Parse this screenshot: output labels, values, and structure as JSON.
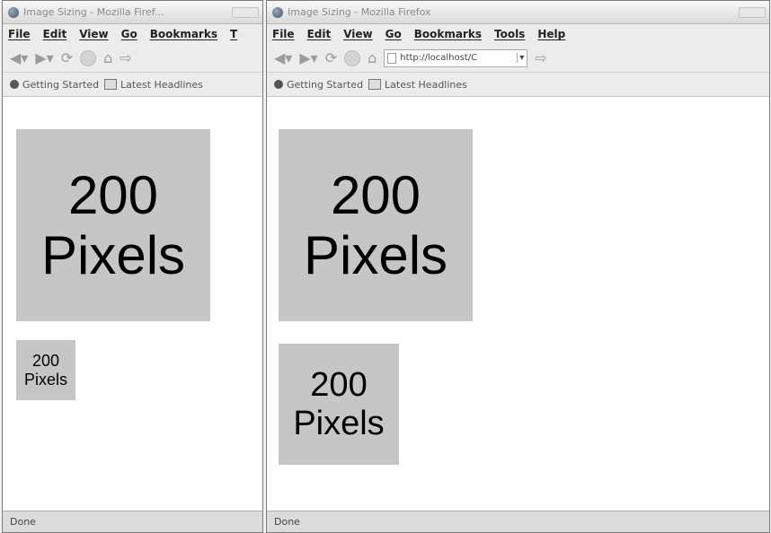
{
  "windows": {
    "left": {
      "title": "Image Sizing - Mozilla Firef...",
      "menu": [
        "File",
        "Edit",
        "View",
        "Go",
        "Bookmarks",
        "T"
      ],
      "bookmarks": [
        "Getting Started",
        "Latest Headlines"
      ],
      "large_image": {
        "line1": "200",
        "line2": "Pixels"
      },
      "small_image": {
        "line1": "200",
        "line2": "Pixels"
      },
      "status": "Done"
    },
    "right": {
      "title": "Image Sizing - Mozilla Firefox",
      "menu": [
        "File",
        "Edit",
        "View",
        "Go",
        "Bookmarks",
        "Tools",
        "Help"
      ],
      "url": "http://localhost/C",
      "bookmarks": [
        "Getting Started",
        "Latest Headlines"
      ],
      "large_image": {
        "line1": "200",
        "line2": "Pixels"
      },
      "small_image": {
        "line1": "200",
        "line2": "Pixels"
      },
      "status": "Done"
    }
  },
  "colors": {
    "image_bg": "#c6c6c6",
    "page_bg": "#ffffff",
    "chrome_bg": "#ececec"
  },
  "icons": [
    "back-icon",
    "forward-icon",
    "reload-icon",
    "stop-icon",
    "home-icon",
    "go-icon",
    "globe-icon",
    "bookmark-icon",
    "folder-icon"
  ]
}
